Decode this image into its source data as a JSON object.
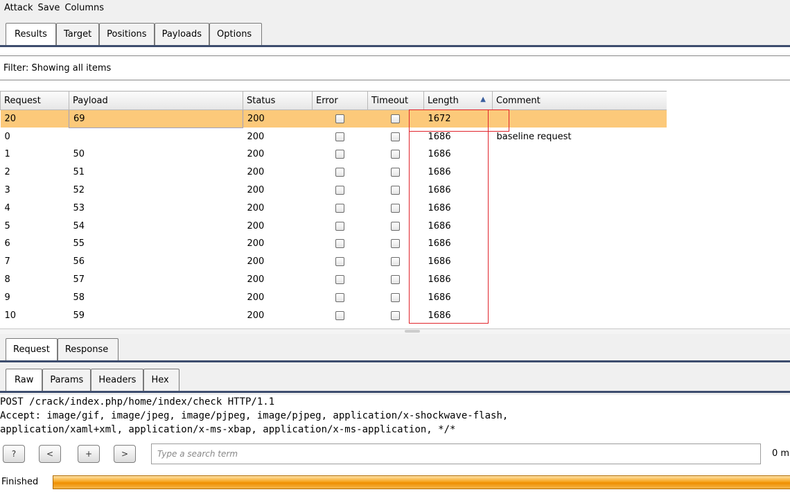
{
  "menu": [
    "Attack",
    "Save",
    "Columns"
  ],
  "main_tabs": [
    "Results",
    "Target",
    "Positions",
    "Payloads",
    "Options"
  ],
  "filter_text": "Filter: Showing all items",
  "columns": [
    "Request",
    "Payload",
    "Status",
    "Error",
    "Timeout",
    "Length",
    "Comment"
  ],
  "sort_indicator": "▲",
  "rows": [
    {
      "request": "20",
      "payload": "69",
      "status": "200",
      "length": "1672",
      "comment": "",
      "selected": true
    },
    {
      "request": "0",
      "payload": "",
      "status": "200",
      "length": "1686",
      "comment": "baseline request"
    },
    {
      "request": "1",
      "payload": "50",
      "status": "200",
      "length": "1686",
      "comment": ""
    },
    {
      "request": "2",
      "payload": "51",
      "status": "200",
      "length": "1686",
      "comment": ""
    },
    {
      "request": "3",
      "payload": "52",
      "status": "200",
      "length": "1686",
      "comment": ""
    },
    {
      "request": "4",
      "payload": "53",
      "status": "200",
      "length": "1686",
      "comment": ""
    },
    {
      "request": "5",
      "payload": "54",
      "status": "200",
      "length": "1686",
      "comment": ""
    },
    {
      "request": "6",
      "payload": "55",
      "status": "200",
      "length": "1686",
      "comment": ""
    },
    {
      "request": "7",
      "payload": "56",
      "status": "200",
      "length": "1686",
      "comment": ""
    },
    {
      "request": "8",
      "payload": "57",
      "status": "200",
      "length": "1686",
      "comment": ""
    },
    {
      "request": "9",
      "payload": "58",
      "status": "200",
      "length": "1686",
      "comment": ""
    },
    {
      "request": "10",
      "payload": "59",
      "status": "200",
      "length": "1686",
      "comment": ""
    }
  ],
  "request_tabs": [
    "Request",
    "Response"
  ],
  "view_tabs": [
    "Raw",
    "Params",
    "Headers",
    "Hex"
  ],
  "raw_lines": [
    "POST /crack/index.php/home/index/check HTTP/1.1",
    "Accept: image/gif, image/jpeg, image/pjpeg, image/pjpeg, application/x-shockwave-flash,",
    "application/xaml+xml, application/x-ms-xbap, application/x-ms-application, */*"
  ],
  "search": {
    "help": "?",
    "prev": "<",
    "add": "+",
    "next": ">",
    "placeholder": "Type a search term",
    "matches": "0 m"
  },
  "status_label": "Finished",
  "colors": {
    "selected_row": "#fcc97a",
    "highlight_box": "#e0242b",
    "progress": "#f7a51f"
  }
}
